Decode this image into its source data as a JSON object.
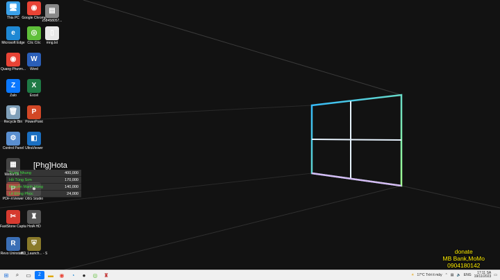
{
  "desktop_icons": [
    {
      "name": "this-pc",
      "label": "This PC",
      "icon": "monitor-icon",
      "color": "#3aa0e8",
      "glyph": "🖥"
    },
    {
      "name": "google-chrome",
      "label": "Google Chrome",
      "icon": "chrome-icon",
      "color": "#e84335",
      "glyph": "◉"
    },
    {
      "name": "file-image",
      "label": "z58458057...",
      "icon": "image-file-icon",
      "color": "#888888",
      "glyph": "▤"
    },
    {
      "name": "microsoft-edge",
      "label": "Microsoft Edge",
      "icon": "edge-icon",
      "color": "#1e88d4",
      "glyph": "e"
    },
    {
      "name": "coc-coc",
      "label": "Cốc Cốc",
      "icon": "coccoc-icon",
      "color": "#5fbf3a",
      "glyph": "◎"
    },
    {
      "name": "mng-txt",
      "label": "mng.txt",
      "icon": "text-file-icon",
      "color": "#e8e8e8",
      "glyph": "▯"
    },
    {
      "name": "quang-phuon",
      "label": "Quang Phươn...",
      "icon": "chrome-icon",
      "color": "#e84335",
      "glyph": "◉"
    },
    {
      "name": "word",
      "label": "Word",
      "icon": "word-icon",
      "color": "#2b5fb8",
      "glyph": "W"
    },
    {
      "name": "zalo",
      "label": "Zalo",
      "icon": "zalo-icon",
      "color": "#0a78ff",
      "glyph": "Z"
    },
    {
      "name": "excel",
      "label": "Excel",
      "icon": "excel-icon",
      "color": "#1f7a45",
      "glyph": "X"
    },
    {
      "name": "recycle-bin",
      "label": "Recycle Bin",
      "icon": "recycle-bin-icon",
      "color": "#7f9fb8",
      "glyph": "🗑"
    },
    {
      "name": "powerpoint",
      "label": "PowerPoint",
      "icon": "powerpoint-icon",
      "color": "#d24726",
      "glyph": "P"
    },
    {
      "name": "control-panel",
      "label": "Control Panel",
      "icon": "control-panel-icon",
      "color": "#5a8fd0",
      "glyph": "⚙"
    },
    {
      "name": "ultraviewer",
      "label": "UltraViewer",
      "icon": "ultraviewer-icon",
      "color": "#1b6fc1",
      "glyph": "◧"
    },
    {
      "name": "media-client",
      "label": "Media Cli...",
      "icon": "media-icon",
      "color": "#444444",
      "glyph": "▦"
    },
    {
      "name": "pdf-xviewer",
      "label": "PDF-XViewer",
      "icon": "pdf-icon",
      "color": "#c0392b",
      "glyph": "P"
    },
    {
      "name": "obs-studio",
      "label": "OBS Studio",
      "icon": "obs-icon",
      "color": "#303030",
      "glyph": "●"
    },
    {
      "name": "faststone-capture",
      "label": "FastStone Capture",
      "icon": "faststone-icon",
      "color": "#d63a2f",
      "glyph": "✂"
    },
    {
      "name": "hotak-hd",
      "label": "HotA HD",
      "icon": "hota-icon",
      "color": "#555555",
      "glyph": "♜"
    },
    {
      "name": "revo-uninstall",
      "label": "Revo Uninstall...",
      "icon": "revo-icon",
      "color": "#3b6fb6",
      "glyph": "R"
    },
    {
      "name": "hd-launcher",
      "label": "HD_Launch... - Shortcut",
      "icon": "shield-icon",
      "color": "#8a7a2a",
      "glyph": "⛨"
    }
  ],
  "overlay": {
    "title": "[Phg]Hota",
    "donations": [
      {
        "name": "Trung Nhung",
        "amount": "400,000"
      },
      {
        "name": "Hồ Tùng Sơn",
        "amount": "170,000"
      },
      {
        "name": "Nguyễn Mạnh Hùng",
        "amount": "140,000"
      },
      {
        "name": "Lê Đông Phúc",
        "amount": "24,000"
      }
    ]
  },
  "donate": {
    "line1": "donate",
    "line2": "MB Bank,MoMo",
    "line3": "0904180142"
  },
  "taskbar": {
    "weather": "17°C Trời it mây",
    "language": "ENG",
    "time": "17:11 SA",
    "date": "19/11/2023"
  },
  "colors": {
    "donate_text": "#ffee00",
    "donor_name": "#3fe03f",
    "window_logo_blue": "#3fb7ff",
    "window_logo_green": "#7fff7f"
  }
}
